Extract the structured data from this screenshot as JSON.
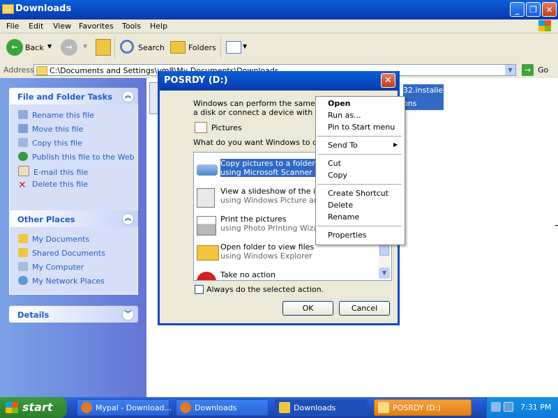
{
  "window": {
    "title": "Downloads"
  },
  "menubar": [
    "File",
    "Edit",
    "View",
    "Favorites",
    "Tools",
    "Help"
  ],
  "toolbar": {
    "back": "Back",
    "search": "Search",
    "folders": "Folders"
  },
  "address": {
    "label": "Address",
    "value": "C:\\Documents and Settings\\vm8\\My Documents\\Downloads",
    "go": "Go"
  },
  "file_tasks": {
    "title": "File and Folder Tasks",
    "items": [
      "Rename this file",
      "Move this file",
      "Copy this file",
      "Publish this file to the Web",
      "E-mail this file",
      "Delete this file"
    ]
  },
  "other_places": {
    "title": "Other Places",
    "items": [
      "My Documents",
      "Shared Documents",
      "My Computer",
      "My Network Places"
    ]
  },
  "details": {
    "title": "Details"
  },
  "selected_file": {
    "line1": "32.installer(1)",
    "line2": "ons"
  },
  "dialog": {
    "title": "POSRDY (D:)",
    "intro_line1": "Windows can perform the same actio",
    "intro_line2": "a disk or connect a device with this k",
    "content_type": "Pictures",
    "question": "What do you want Windows to do?",
    "actions": [
      {
        "line1": "Copy pictures to a folder on m",
        "line2": "using Microsoft Scanner and"
      },
      {
        "line1": "View a slideshow of the imag",
        "line2": "using Windows Picture and F"
      },
      {
        "line1": "Print the pictures",
        "line2": "using Photo Printing Wizard"
      },
      {
        "line1": "Open folder to view files",
        "line2": "using Windows Explorer"
      },
      {
        "line1": "Take no action",
        "line2": ""
      }
    ],
    "checkbox": "Always do the selected action.",
    "ok": "OK",
    "cancel": "Cancel"
  },
  "context_menu": {
    "open": "Open",
    "run_as": "Run as...",
    "pin": "Pin to Start menu",
    "send_to": "Send To",
    "cut": "Cut",
    "copy": "Copy",
    "create_shortcut": "Create Shortcut",
    "delete": "Delete",
    "rename": "Rename",
    "properties": "Properties"
  },
  "taskbar": {
    "start": "start",
    "items": [
      "Mypal - Download...",
      "Downloads",
      "Downloads",
      "POSRDY (D:)"
    ],
    "clock": "7:31 PM"
  }
}
